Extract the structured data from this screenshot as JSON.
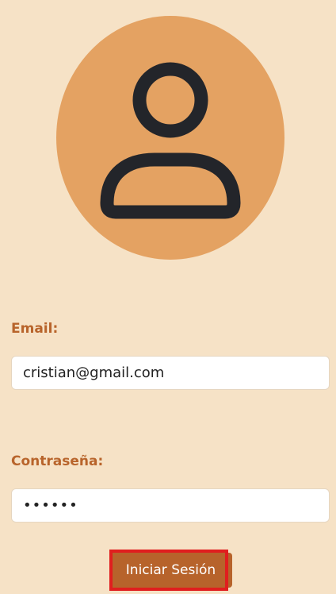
{
  "avatar": {
    "icon": "user-icon",
    "background_color": "#e4a262",
    "stroke_color": "#23252a"
  },
  "login_form": {
    "email_label": "Email:",
    "email_value": "cristian@gmail.com",
    "password_label": "Contraseña:",
    "password_value": "••••••",
    "submit_label": "Iniciar Sesión"
  },
  "colors": {
    "page_background": "#f6e2c6",
    "label_text": "#b8642b",
    "button_background": "#b7632b",
    "highlight_border": "#e01e1e"
  }
}
